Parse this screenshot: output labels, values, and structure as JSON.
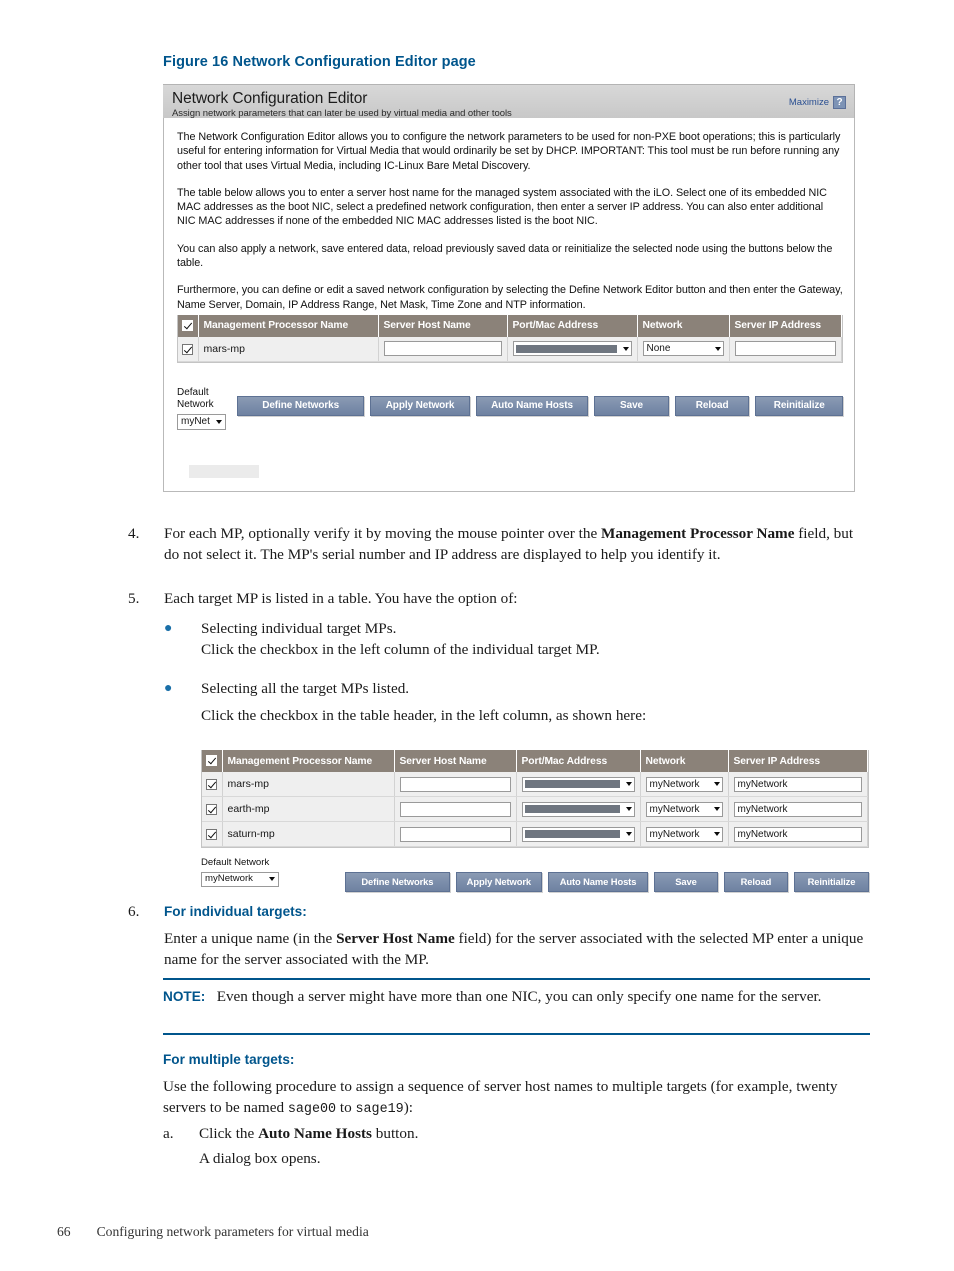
{
  "figure": {
    "caption": "Figure 16 Network Configuration Editor page"
  },
  "editor": {
    "title": "Network Configuration Editor",
    "subtitle": "Assign network parameters that can later be used by virtual media and other tools",
    "maximize_label": "Maximize",
    "help_icon_glyph": "?",
    "paragraphs": [
      "The Network Configuration Editor allows you to configure the network parameters to be used for non-PXE boot operations; this is particularly useful for entering information for Virtual Media that would ordinarily be set by DHCP. IMPORTANT: This tool must be run before running any other tool that uses Virtual Media, including IC-Linux Bare Metal Discovery.",
      "The table below allows you to enter a server host name for the managed system associated with the iLO. Select one of its embedded NIC MAC addresses as the boot NIC, select a predefined network configuration, then enter a server IP address. You can also enter additional NIC MAC addresses if none of the embedded NIC MAC addresses listed is the boot NIC.",
      "You can also apply a network, save entered data, reload previously saved data or reinitialize the selected node using the buttons below the table.",
      "Furthermore, you can define or edit a saved network configuration by selecting the Define Network Editor button and then enter the Gateway, Name Server, Domain, IP Address Range, Net Mask, Time Zone and NTP information."
    ],
    "table": {
      "columns": [
        "Management Processor Name",
        "Server Host Name",
        "Port/Mac Address",
        "Network",
        "Server IP Address"
      ],
      "rows": [
        {
          "selected": true,
          "mp_name": "mars-mp",
          "server_host_name": "",
          "port_mac_address": "",
          "network": "None",
          "server_ip_address": ""
        }
      ]
    },
    "default_network": {
      "label_line1": "Default",
      "label_line2": "Network",
      "value": "myNet"
    },
    "buttons": {
      "define_networks": "Define Networks",
      "apply_network": "Apply Network",
      "auto_name_hosts": "Auto Name Hosts",
      "save": "Save",
      "reload": "Reload",
      "reinitialize": "Reinitialize"
    }
  },
  "editor2": {
    "table": {
      "columns": [
        "Management Processor Name",
        "Server Host Name",
        "Port/Mac Address",
        "Network",
        "Server IP Address"
      ],
      "rows": [
        {
          "selected": true,
          "mp_name": "mars-mp",
          "server_host_name": "",
          "port_mac_address": "",
          "network": "myNetwork",
          "server_ip_address": "myNetwork"
        },
        {
          "selected": true,
          "mp_name": "earth-mp",
          "server_host_name": "",
          "port_mac_address": "",
          "network": "myNetwork",
          "server_ip_address": "myNetwork"
        },
        {
          "selected": true,
          "mp_name": "saturn-mp",
          "server_host_name": "",
          "port_mac_address": "",
          "network": "myNetwork",
          "server_ip_address": "myNetwork"
        }
      ]
    },
    "default_network": {
      "label": "Default Network",
      "value": "myNetwork"
    },
    "buttons": {
      "define_networks": "Define Networks",
      "apply_network": "Apply Network",
      "auto_name_hosts": "Auto Name Hosts",
      "save": "Save",
      "reload": "Reload",
      "reinitialize": "Reinitialize"
    }
  },
  "steps": {
    "step4": {
      "number": "4.",
      "part1": "For each MP, optionally verify it by moving the mouse pointer over the ",
      "bold1": "Management Processor Name",
      "part2": " field, but do not select it. The MP's serial number and IP address are displayed to help you identify it."
    },
    "step5": {
      "number": "5.",
      "text": "Each target MP is listed in a table. You have the option of:",
      "bullet1": "Selecting individual target MPs.",
      "bullet1_sub": "Click the checkbox in the left column of the individual target MP.",
      "bullet2": "Selecting all the target MPs listed.",
      "bullet2_sub": "Click the checkbox in the table header, in the left column, as shown here:"
    },
    "step6": {
      "number": "6.",
      "heading": "For individual targets:",
      "part1": "Enter a unique name (in the ",
      "bold1": "Server Host Name",
      "part2": " field) for the server associated with the selected MP enter a unique name for the server associated with the MP."
    },
    "note": {
      "label": "NOTE:",
      "text": "Even though a server might have more than one NIC, you can only specify one name for the server."
    },
    "multiple": {
      "heading": "For multiple targets:",
      "part1": "Use the following procedure to assign a sequence of server host names to multiple targets (for example, twenty servers to be named ",
      "mono1": "sage00",
      "part2": " to ",
      "mono2": "sage19",
      "part3": "):",
      "sub_a_number": "a.",
      "sub_a_part1": "Click the ",
      "sub_a_bold": "Auto Name Hosts",
      "sub_a_part2": " button.",
      "sub_a_followup": "A dialog box opens."
    }
  },
  "footer": {
    "page_number": "66",
    "chapter": "Configuring network parameters for virtual media"
  },
  "colors": {
    "heading_blue": "#00558c",
    "table_header": "#8b8279",
    "button_blue": "#7c8eab",
    "link_blue": "#2a4f91"
  }
}
